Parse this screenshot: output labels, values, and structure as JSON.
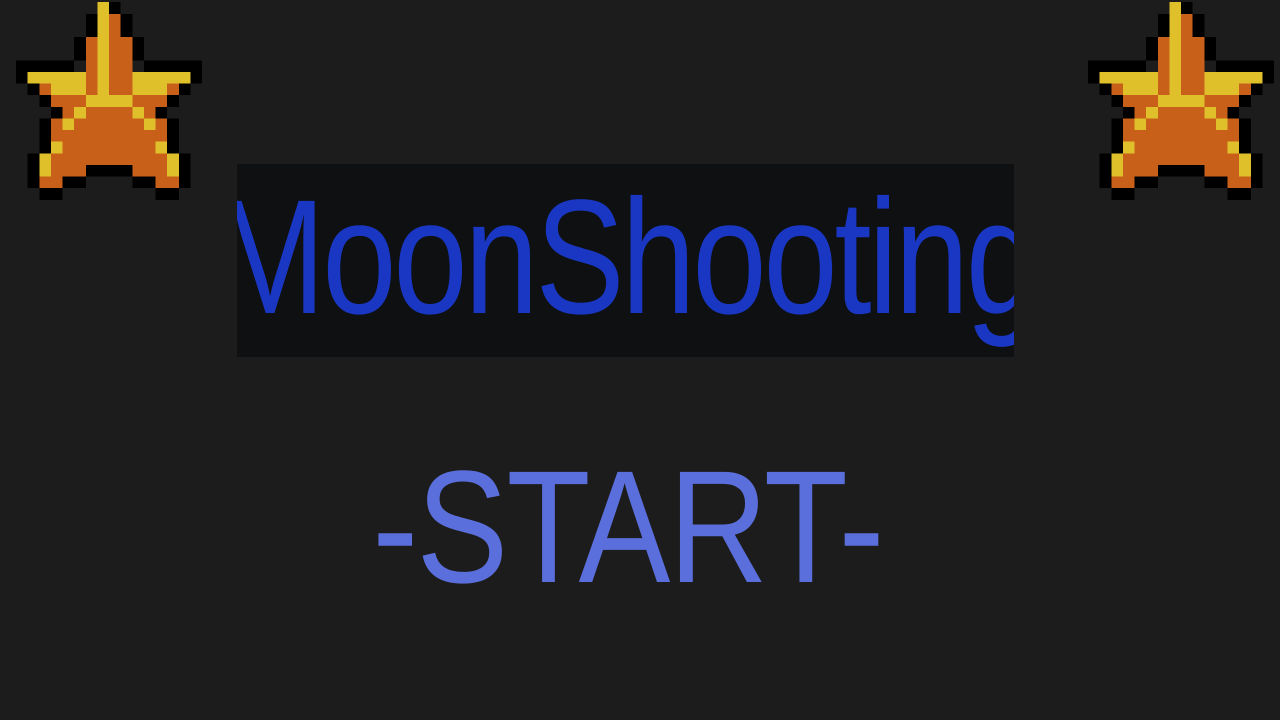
{
  "game": {
    "title": "MoonShooting",
    "start_label": "-START-"
  },
  "decorations": {
    "left_icon": "star-icon",
    "right_icon": "star-icon"
  },
  "colors": {
    "background": "#1c1c1c",
    "title_box": "#0e1011",
    "title_text": "#1a37c4",
    "start_text": "#5b6fdc",
    "star_fill": "#c8601a",
    "star_highlight": "#e0c02a",
    "star_outline": "#000000"
  }
}
